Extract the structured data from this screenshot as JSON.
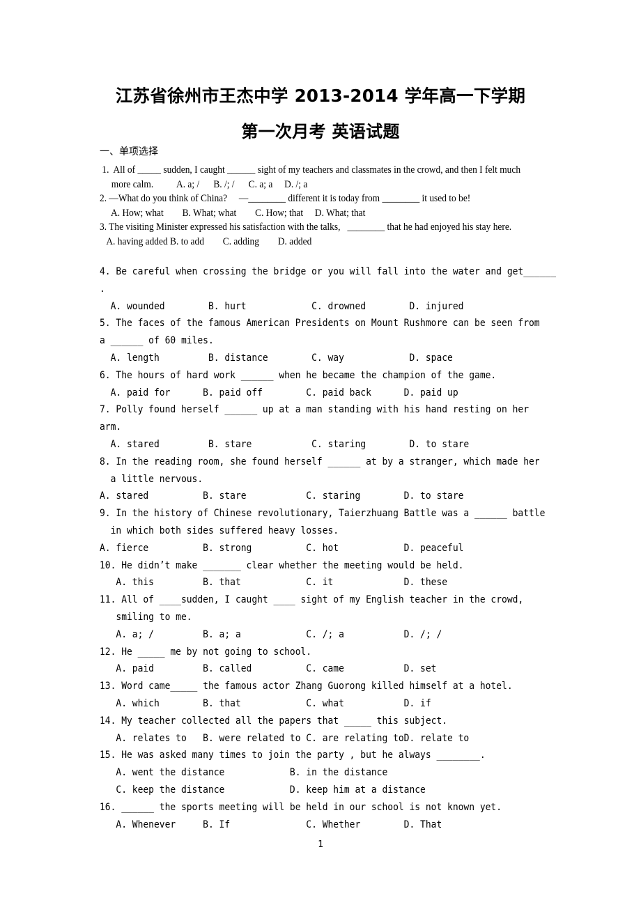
{
  "document": {
    "title_lines": [
      "江苏省徐州市王杰中学 2013-2014 学年高一下学期",
      "第一次月考 英语试题"
    ],
    "section_heading": "一、单项选择",
    "page_number": "1"
  },
  "serif_questions": [
    " 1.  All of _____ sudden, I caught ______ sight of my teachers and classmates in the crowd, and then I felt much",
    "     more calm.          A. a; /      B. /; /      C. a; a     D. /; a",
    "2. —What do you think of China?     —________ different it is today from ________ it used to be!",
    "     A. How; what        B. What; what        C. How; that     D. What; that",
    "3. The visiting Minister expressed his satisfaction with the talks,   ________ that he had enjoyed his stay here.",
    "   A. having added B. to add        C. adding        D. added"
  ],
  "mono_questions": [
    "4. Be careful when crossing the bridge or you will fall into the water and get______",
    ".",
    "  A. wounded        B. hurt            C. drowned        D. injured",
    "5. The faces of the famous American Presidents on Mount Rushmore can be seen from",
    "a ______ of 60 miles.",
    "  A. length         B. distance        C. way            D. space",
    "6. The hours of hard work ______ when he became the champion of the game.",
    "  A. paid for      B. paid off        C. paid back      D. paid up",
    "7. Polly found herself ______ up at a man standing with his hand resting on her",
    "arm.",
    "  A. stared         B. stare           C. staring        D. to stare",
    "8. In the reading room, she found herself ______ at by a stranger, which made her",
    "  a little nervous.",
    "A. stared          B. stare           C. staring        D. to stare",
    "9. In the history of Chinese revolutionary, Taierzhuang Battle was a ______ battle",
    "  in which both sides suffered heavy losses.",
    "A. fierce          B. strong          C. hot            D. peaceful",
    "10. He didn’t make _______ clear whether the meeting would be held.",
    "   A. this         B. that            C. it             D. these",
    "11. All of ____sudden, I caught ____ sight of my English teacher in the crowd,",
    "   smiling to me.",
    "   A. a; /         B. a; a            C. /; a           D. /; /",
    "12. He _____ me by not going to school.",
    "   A. paid         B. called          C. came           D. set",
    "13. Word came_____ the famous actor Zhang Guorong killed himself at a hotel.",
    "   A. which        B. that            C. what           D. if",
    "14. My teacher collected all the papers that _____ this subject.",
    "   A. relates to   B. were related to C. are relating toD. relate to",
    "15. He was asked many times to join the party , but he always ________.",
    "   A. went the distance            B. in the distance",
    "   C. keep the distance            D. keep him at a distance",
    "16. ______ the sports meeting will be held in our school is not known yet.",
    "   A. Whenever     B. If              C. Whether        D. That"
  ]
}
